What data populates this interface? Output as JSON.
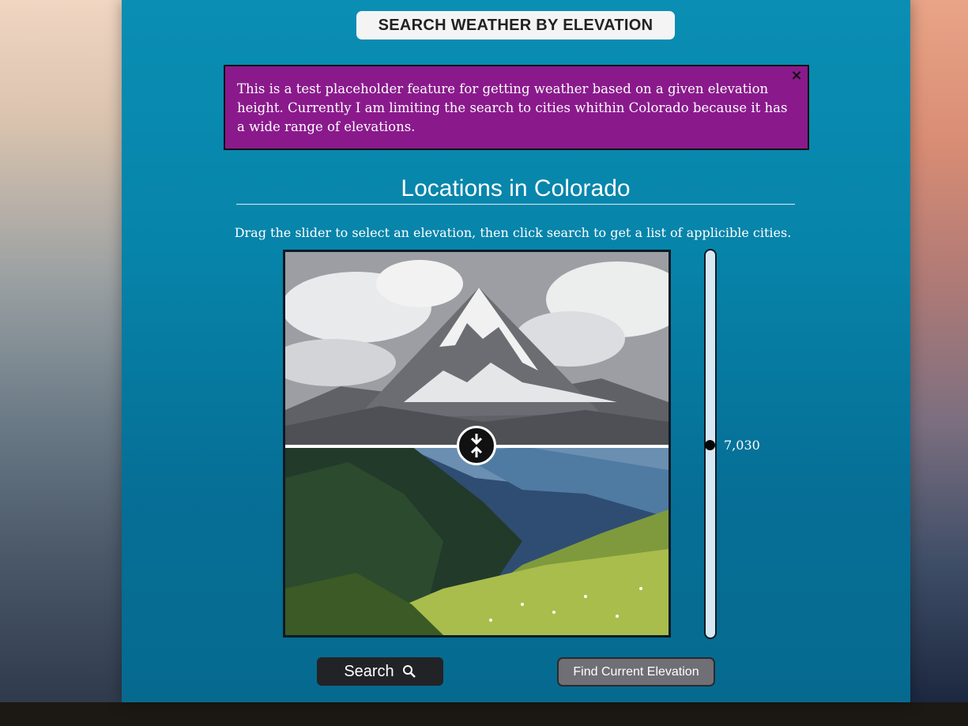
{
  "header": {
    "title": "SEARCH WEATHER BY ELEVATION"
  },
  "notice": {
    "text": "This is a test placeholder feature for getting weather based on a given elevation height. Currently I am limiting the search to cities whithin Colorado because it has a wide range of elevations.",
    "close_label": "×"
  },
  "locations": {
    "title": "Locations in Colorado",
    "instructions": "Drag the slider to select an elevation, then click search to get a list of applicible cities."
  },
  "elevation_slider": {
    "value_label": "7,030",
    "level": 0.5
  },
  "comparison": {
    "split": 0.5,
    "top_image": "grayscale-mountain-peak",
    "bottom_image": "green-valley-meadow"
  },
  "buttons": {
    "search_label": "Search",
    "search_icon": "magnifier-icon",
    "find_elevation_label": "Find Current Elevation"
  },
  "colors": {
    "panel": "#0784aa",
    "notice_bg": "#8a1a8c",
    "search_bg": "#222326",
    "find_bg": "#6f6f75"
  }
}
